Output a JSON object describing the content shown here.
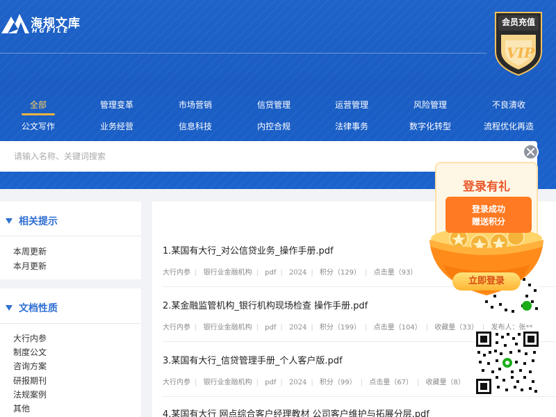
{
  "brand": {
    "name": "海规文库",
    "sub": "HGFILE"
  },
  "vip": {
    "label": "会员充值",
    "badge": "VIP"
  },
  "categories": [
    [
      "全部",
      "管理变革",
      "市场营销",
      "信贷管理",
      "运营管理",
      "风险管理",
      "不良清收"
    ],
    [
      "公文写作",
      "业务经营",
      "信息科技",
      "内控合规",
      "法律事务",
      "数字化转型",
      "流程优化再造"
    ]
  ],
  "active_category": "全部",
  "search": {
    "placeholder": "请输入名称、关键词搜索"
  },
  "sidebar": {
    "tips": {
      "title": "相关提示",
      "items": [
        "本周更新",
        "本月更新"
      ]
    },
    "nature": {
      "title": "文档性质",
      "items": [
        "大行内参",
        "制度公文",
        "咨询方案",
        "研报期刊",
        "法规案例",
        "其他"
      ]
    }
  },
  "docs": [
    {
      "title": "1.某国有大行_对公信贷业务_操作手册.pdf",
      "meta": [
        "大行内参",
        "银行业金融机构",
        "pdf",
        "2024",
        "积分（129）",
        "点击量（93）"
      ]
    },
    {
      "title": "2.某金融监管机构_银行机构现场检查 操作手册.pdf",
      "meta": [
        "大行内参",
        "银行业金融机构",
        "pdf",
        "2024",
        "积分（199）",
        "点击量（104）",
        "收藏量（33）",
        "发布人：张**"
      ]
    },
    {
      "title": "3.某国有大行_信贷管理手册_个人客户版.pdf",
      "meta": [
        "大行内参",
        "银行业金融机构",
        "pdf",
        "2024",
        "积分（99）",
        "点击量（67）",
        "收藏量（8）"
      ]
    },
    {
      "title": "4.某国有大行 网点综合客户经理教材 公司客户维护与拓展分层.pdf",
      "meta": []
    }
  ],
  "popup": {
    "title": "登录有礼",
    "line1": "登录成功",
    "line2": "赠送积分",
    "button": "立即登录"
  },
  "colors": {
    "header_blue": "#1a5cc2",
    "accent_blue": "#2f6fd2",
    "active_yellow": "#ffd25a",
    "popup_orange": "#ff7a22"
  }
}
